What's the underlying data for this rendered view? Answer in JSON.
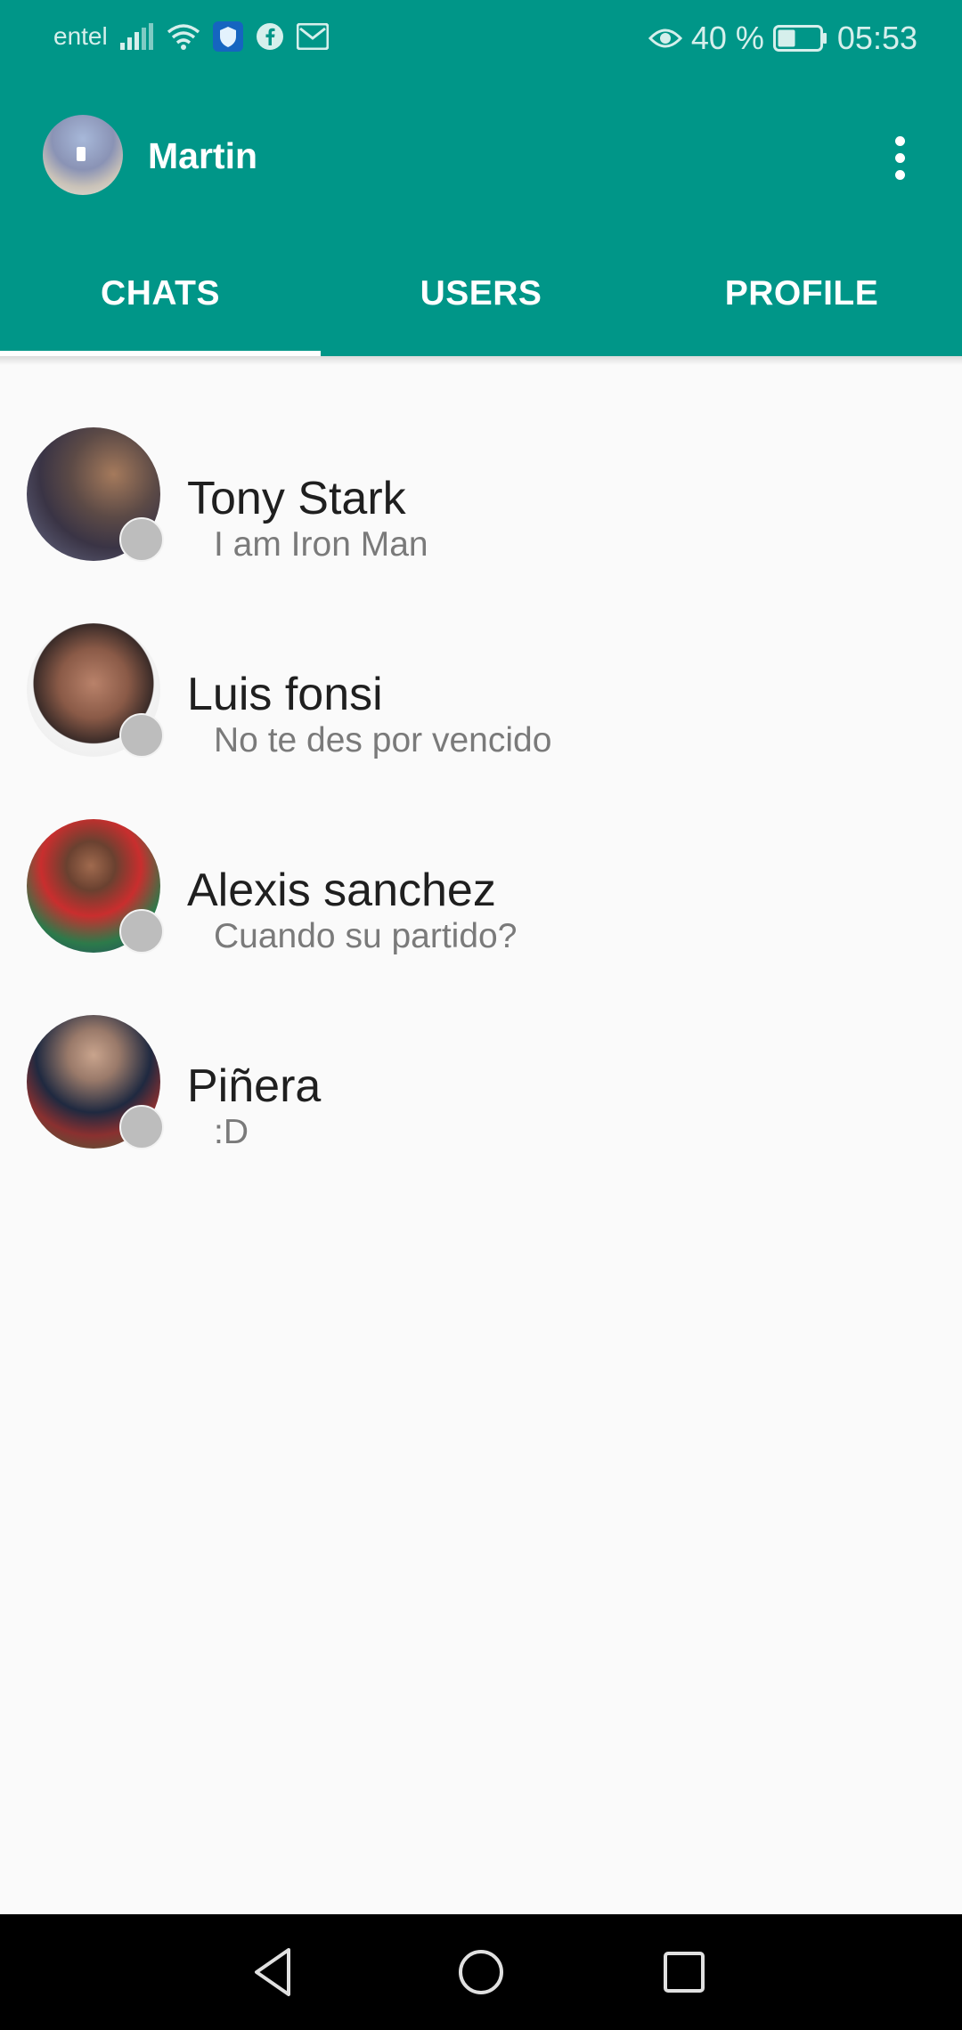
{
  "status_bar": {
    "carrier": "entel",
    "battery": "40 %",
    "time": "05:53"
  },
  "app_bar": {
    "title": "Martin"
  },
  "tabs": [
    {
      "label": "CHATS",
      "active": true
    },
    {
      "label": "USERS",
      "active": false
    },
    {
      "label": "PROFILE",
      "active": false
    }
  ],
  "chats": [
    {
      "name": "Tony Stark",
      "message": "I am Iron Man"
    },
    {
      "name": "Luis fonsi",
      "message": "No te des por vencido"
    },
    {
      "name": "Alexis sanchez",
      "message": "Cuando su partido?"
    },
    {
      "name": "Piñera",
      "message": ":D"
    }
  ],
  "colors": {
    "primary": "#009688",
    "background": "#fafafa",
    "status_offline": "#bdbdbd"
  }
}
